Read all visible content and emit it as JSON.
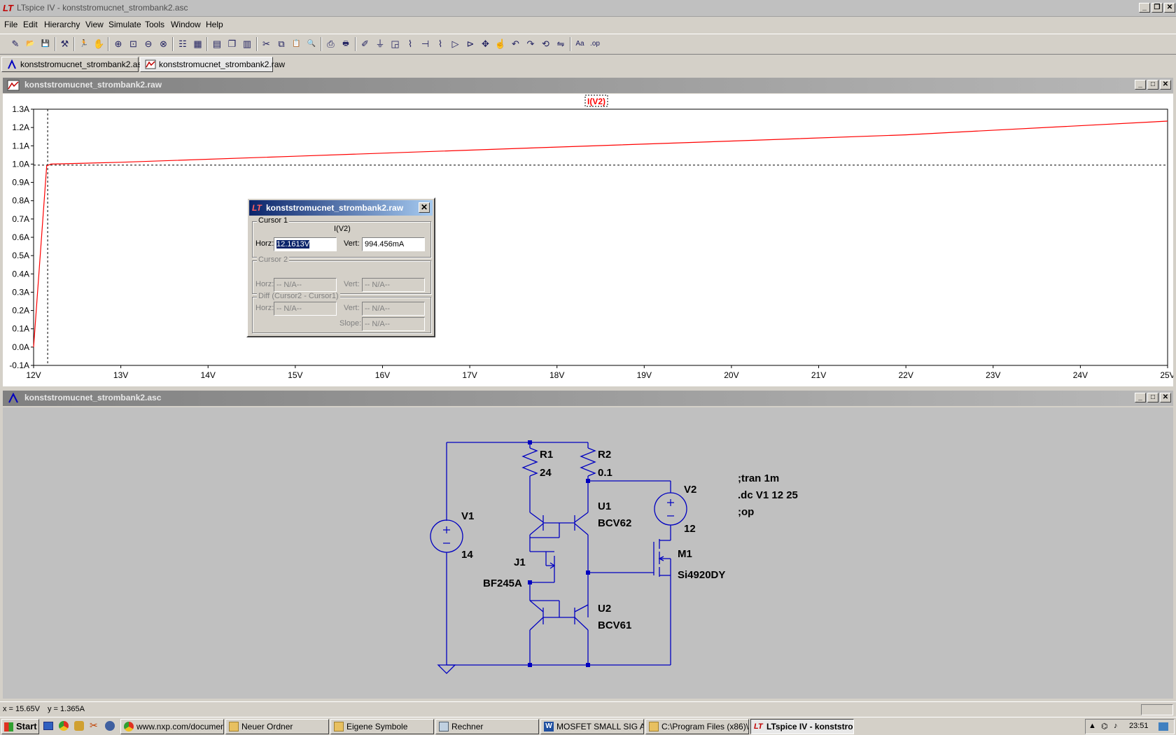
{
  "app": {
    "title": "LTspice IV - konststromucnet_strombank2.asc"
  },
  "menu": [
    "File",
    "Edit",
    "Hierarchy",
    "View",
    "Simulate",
    "Tools",
    "Window",
    "Help"
  ],
  "toolbar": {
    "icons": [
      "new-schematic-icon",
      "open-icon",
      "save-icon",
      "control-panel-icon",
      "run-icon",
      "halt-icon",
      "zoom-in-icon",
      "zoom-area-icon",
      "zoom-out-icon",
      "zoom-fit-icon",
      "autorange-icon",
      "grid-icon",
      "tile-horizontal-icon",
      "cascade-icon",
      "tile-vertical-icon",
      "cut-icon",
      "copy-icon",
      "paste-icon",
      "find-icon",
      "print-setup-icon",
      "print-icon",
      "wire-icon",
      "ground-icon",
      "label-icon",
      "resistor-icon",
      "capacitor-icon",
      "inductor-icon",
      "diode-icon",
      "component-icon",
      "move-icon",
      "drag-icon",
      "undo-icon",
      "redo-icon",
      "rotate-icon",
      "mirror-icon",
      "text-icon",
      "spice-directive-icon"
    ]
  },
  "tabs": [
    {
      "label": "konststromucnet_strombank2.asc"
    },
    {
      "label": "konststromucnet_strombank2.raw"
    }
  ],
  "plot_window": {
    "title": "konststromucnet_strombank2.raw"
  },
  "schematic_window": {
    "title": "konststromucnet_strombank2.asc"
  },
  "chart_data": {
    "type": "line",
    "trace_label": "I(V2)",
    "trace_color": "#ff0000",
    "xlim": [
      12,
      25
    ],
    "ylim": [
      -0.1,
      1.3
    ],
    "x_ticks": [
      "12V",
      "13V",
      "14V",
      "15V",
      "16V",
      "17V",
      "18V",
      "19V",
      "20V",
      "21V",
      "22V",
      "23V",
      "24V",
      "25V"
    ],
    "y_ticks": [
      "-0.1A",
      "0.0A",
      "0.1A",
      "0.2A",
      "0.3A",
      "0.4A",
      "0.5A",
      "0.6A",
      "0.7A",
      "0.8A",
      "0.9A",
      "1.0A",
      "1.1A",
      "1.2A",
      "1.3A"
    ],
    "series": [
      {
        "name": "I(V2)",
        "x": [
          12.0,
          12.15,
          12.2,
          13,
          15,
          18,
          20,
          22,
          25
        ],
        "y": [
          0.0,
          0.99,
          1.0,
          1.01,
          1.043,
          1.093,
          1.126,
          1.16,
          1.235
        ]
      }
    ],
    "cursor": {
      "x": 12.1613,
      "y": 0.994456
    }
  },
  "cursor_dialog": {
    "title": "konststromucnet_strombank2.raw",
    "cursor1_legend": "Cursor 1",
    "trace": "I(V2)",
    "horz_label": "Horz:",
    "vert_label": "Vert:",
    "horz_value": "12.1613V",
    "vert_value": "994.456mA",
    "cursor2_legend": "Cursor 2",
    "na": "-- N/A--",
    "diff_legend": "Diff (Cursor2 - Cursor1)",
    "slope_label": "Slope:"
  },
  "schematic": {
    "components": {
      "r1_name": "R1",
      "r1_value": "24",
      "r2_name": "R2",
      "r2_value": "0.1",
      "v1_name": "V1",
      "v1_value": "14",
      "v2_name": "V2",
      "v2_value": "12",
      "u1_name": "U1",
      "u1_value": "BCV62",
      "u2_name": "U2",
      "u2_value": "BCV61",
      "j1_name": "J1",
      "j1_value": "BF245A",
      "m1_name": "M1",
      "m1_value": "Si4920DY"
    },
    "directives": [
      ";tran 1m",
      ".dc V1 12 25",
      ";op"
    ],
    "wire_color": "#0000c0"
  },
  "status": {
    "x_readout": "x = 15.65V",
    "y_readout": "y = 1.365A"
  },
  "taskbar": {
    "start_label": "Start",
    "tasks": [
      {
        "label": "www.nxp.com/document..."
      },
      {
        "label": "Neuer Ordner"
      },
      {
        "label": "Eigene Symbole"
      },
      {
        "label": "Rechner"
      },
      {
        "label": "MOSFET SMALL SIG AND..."
      },
      {
        "label": "C:\\Program Files (x86)\\L..."
      },
      {
        "label": "LTspice IV - konststro..."
      }
    ],
    "clock": "23:51"
  }
}
